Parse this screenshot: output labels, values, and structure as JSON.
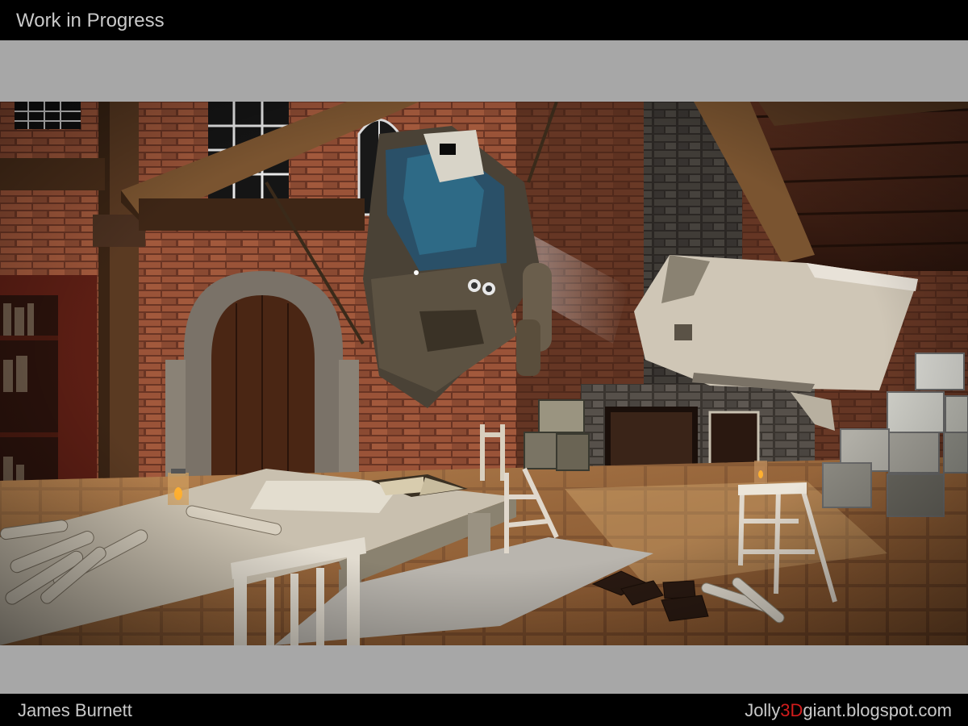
{
  "header": {
    "title": "Work in Progress"
  },
  "footer": {
    "author": "James Burnett",
    "blog_prefix": "Jolly",
    "blog_accent": "3D",
    "blog_suffix": "giant.blogspot.com"
  },
  "colors": {
    "bar": "#000000",
    "border_grey": "#a7a7a7",
    "text": "#c9c9c9",
    "accent": "#d21c1c"
  }
}
